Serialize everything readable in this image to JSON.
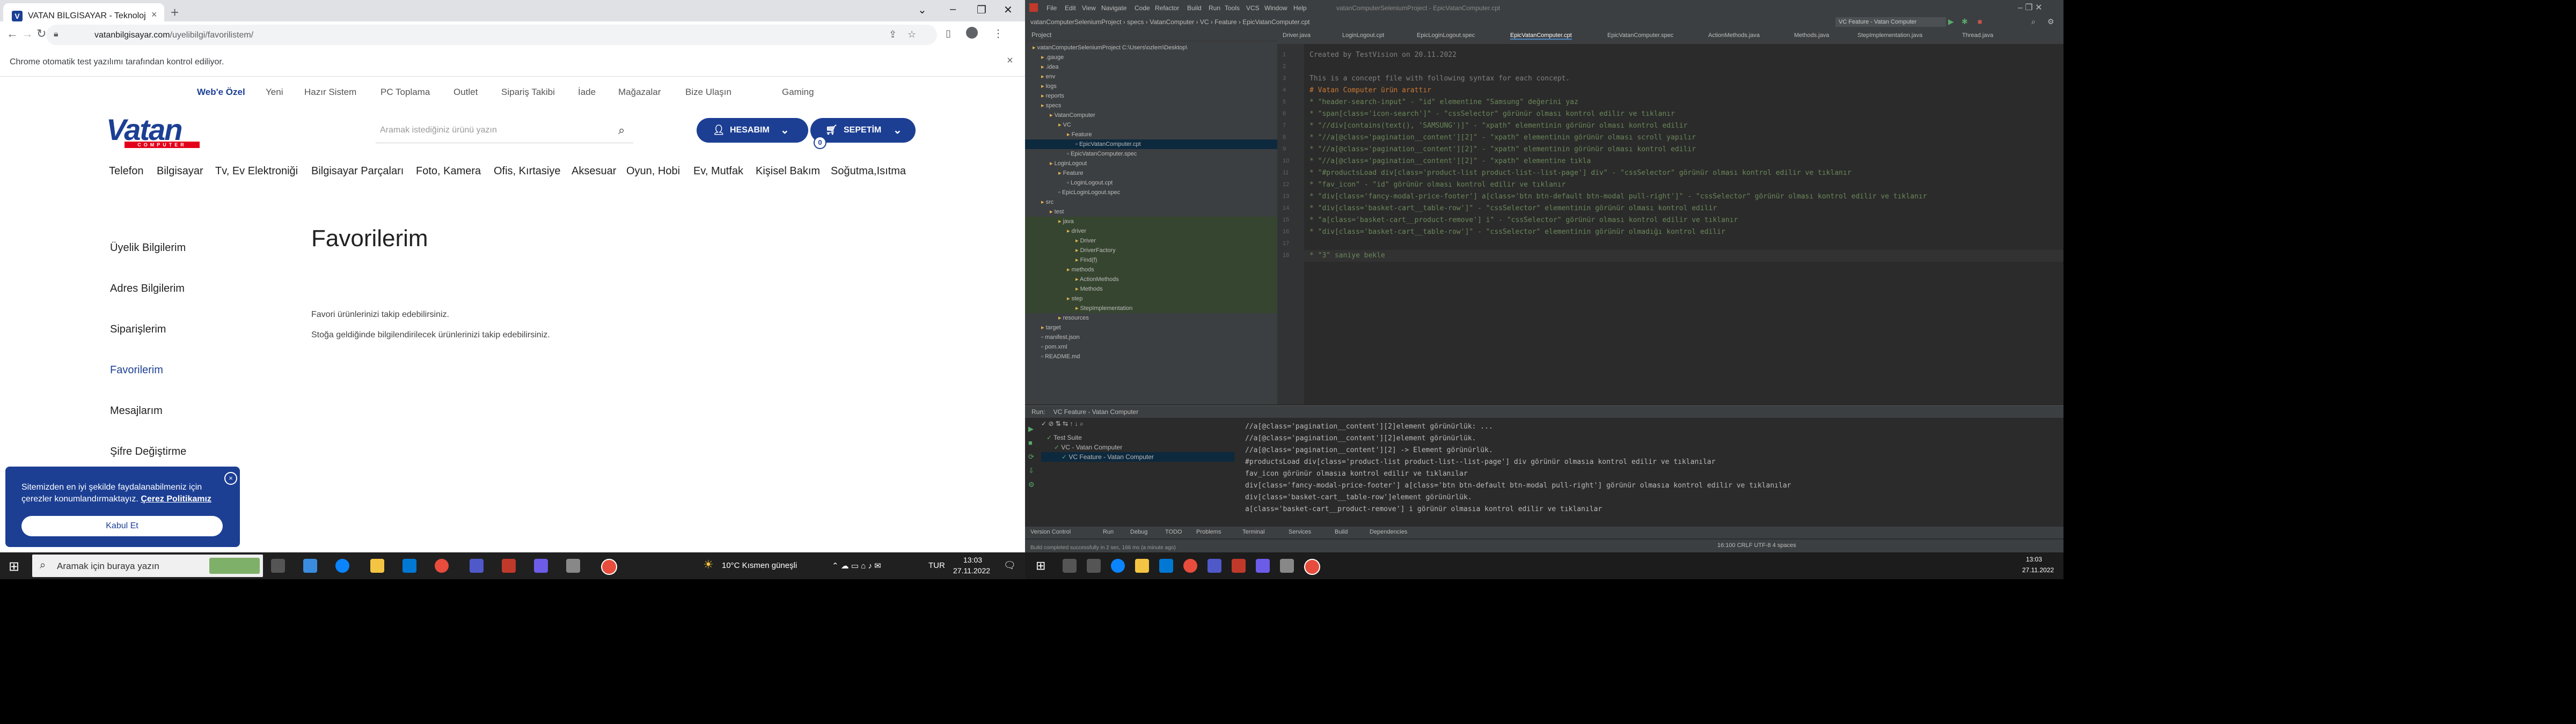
{
  "browser": {
    "tab_title": "VATAN BİLGİSAYAR - Teknoloji d...",
    "tab_close": "×",
    "new_tab": "+",
    "url_host": "vatanbilgisayar.com",
    "url_path": "/uyelibilgi/favorilistem/",
    "infobar_text": "Chrome otomatik test yazılımı tarafından kontrol ediliyor.",
    "infobar_close": "×"
  },
  "site": {
    "top_links": [
      "Web'e Özel",
      "Yeni",
      "Hazır Sistem",
      "PC Toplama",
      "Outlet",
      "Sipariş Takibi",
      "İade",
      "Mağazalar",
      "Bize Ulaşın",
      "Gaming"
    ],
    "logo_text": "Vatan",
    "logo_sub": "COMPUTER",
    "search_placeholder": "Aramak istediğiniz ürünü yazın",
    "account_label": "HESABIM",
    "cart_label": "SEPETİM",
    "cart_count": "0",
    "categories": [
      "Telefon",
      "Bilgisayar",
      "Tv, Ev Elektroniği",
      "Bilgisayar Parçaları",
      "Foto, Kamera",
      "Ofis, Kırtasiye",
      "Aksesuar",
      "Oyun, Hobi",
      "Ev, Mutfak",
      "Kişisel Bakım",
      "Soğutma,Isıtma"
    ],
    "sidebar": [
      "Üyelik Bilgilerim",
      "Adres Bilgilerim",
      "Siparişlerim",
      "Favorilerim",
      "Mesajlarım",
      "Şifre Değiştirme"
    ],
    "page_title": "Favorilerim",
    "info_line_1": "Favori ürünlerinizi takip edebilirsiniz.",
    "info_line_2": "Stoğa geldiğinde bilgilendirilecek ürünlerinizi takip edebilirsiniz.",
    "cookie_text": "Sitemizden en iyi şekilde faydalanabilmeniz için çerezler konumlandırmaktayız.",
    "cookie_link": "Çerez Politikamız",
    "cookie_accept": "Kabul Et",
    "cookie_close": "×"
  },
  "taskbar_left": {
    "search_placeholder": "Aramak için buraya yazın",
    "weather": "10°C  Kısmen güneşli",
    "lang": "TUR",
    "time": "13:03",
    "date": "27.11.2022"
  },
  "taskbar_right": {
    "time": "13:03",
    "date": "27.11.2022"
  },
  "ide": {
    "menu": [
      "File",
      "Edit",
      "View",
      "Navigate",
      "Code",
      "Refactor",
      "Build",
      "Run",
      "Tools",
      "VCS",
      "Window",
      "Help"
    ],
    "title_suffix": "vatanComputerSeleniumProject - EpicVatanComputer.cpt",
    "breadcrumb": "vatanComputerSeleniumProject  ›  specs  ›  VatanComputer  ›  VC  ›  Feature  ›  EpicVatanComputer.cpt",
    "run_config": "VC Feature - Vatan Computer",
    "project_label": "Project",
    "tree": [
      {
        "t": "vatanComputerSeleniumProject  C:\\Users\\ozlem\\Desktop\\",
        "d": 0
      },
      {
        "t": ".gauge",
        "d": 1
      },
      {
        "t": ".idea",
        "d": 1
      },
      {
        "t": "env",
        "d": 1
      },
      {
        "t": "logs",
        "d": 1
      },
      {
        "t": "reports",
        "d": 1
      },
      {
        "t": "specs",
        "d": 1
      },
      {
        "t": "VatanComputer",
        "d": 2
      },
      {
        "t": "VC",
        "d": 3
      },
      {
        "t": "Feature",
        "d": 4
      },
      {
        "t": "EpicVatanComputer.cpt",
        "d": 5,
        "sel": true
      },
      {
        "t": "EpicVatanComputer.spec",
        "d": 4
      },
      {
        "t": "LoginLogout",
        "d": 2
      },
      {
        "t": "Feature",
        "d": 3
      },
      {
        "t": "LoginLogout.cpt",
        "d": 4
      },
      {
        "t": "EpicLoginLogout.spec",
        "d": 3
      },
      {
        "t": "src",
        "d": 1
      },
      {
        "t": "test",
        "d": 2
      },
      {
        "t": "java",
        "d": 3,
        "green": true
      },
      {
        "t": "driver",
        "d": 4,
        "green": true
      },
      {
        "t": "Driver",
        "d": 5,
        "green": true
      },
      {
        "t": "DriverFactory",
        "d": 5,
        "green": true
      },
      {
        "t": "Find(f)",
        "d": 5,
        "green": true
      },
      {
        "t": "methods",
        "d": 4,
        "green": true
      },
      {
        "t": "ActionMethods",
        "d": 5,
        "green": true
      },
      {
        "t": "Methods",
        "d": 5,
        "green": true
      },
      {
        "t": "step",
        "d": 4,
        "green": true
      },
      {
        "t": "StepImplementation",
        "d": 5,
        "green": true
      },
      {
        "t": "resources",
        "d": 3
      },
      {
        "t": "target",
        "d": 1
      },
      {
        "t": "manifest.json",
        "d": 1
      },
      {
        "t": "pom.xml",
        "d": 1
      },
      {
        "t": "README.md",
        "d": 1
      }
    ],
    "editor_tabs": [
      "Driver.java",
      "LoginLogout.cpt",
      "EpicLoginLogout.spec",
      "EpicVatanComputer.cpt",
      "EpicVatanComputer.spec",
      "ActionMethods.java",
      "Methods.java",
      "StepImplementation.java",
      "Thread.java"
    ],
    "active_tab_index": 3,
    "code_lines": [
      {
        "n": "1",
        "t": "Created by TestVision on 20.11.2022",
        "c": "c-comment"
      },
      {
        "n": "2",
        "t": "",
        "c": ""
      },
      {
        "n": "3",
        "t": "This is a concept file with following syntax for each concept.",
        "c": "c-comment"
      },
      {
        "n": "4",
        "t": "# Vatan Computer ürün arattır",
        "c": "c-kw"
      },
      {
        "n": "5",
        "t": "* \"header-search-input\" - \"id\" elementine \"Samsung\" değerini yaz",
        "c": "c-green"
      },
      {
        "n": "6",
        "t": "* \"span[class='icon-search']\" - \"cssSelector\" görünür olması kontrol edilir ve tıklanır",
        "c": "c-green"
      },
      {
        "n": "7",
        "t": "* \"//div[contains(text(), 'SAMSUNG')]\" - \"xpath\" elementinin görünür olması kontrol edilir",
        "c": "c-green"
      },
      {
        "n": "8",
        "t": "* \"//a[@class='pagination__content'][2]\" - \"xpath\" elementinin görünür olması scroll yapılır",
        "c": "c-green"
      },
      {
        "n": "9",
        "t": "* \"//a[@class='pagination__content'][2]\" - \"xpath\" elementinin görünür olması kontrol edilir",
        "c": "c-green"
      },
      {
        "n": "10",
        "t": "* \"//a[@class='pagination__content'][2]\" - \"xpath\" elementine tıkla",
        "c": "c-green"
      },
      {
        "n": "11",
        "t": "* \"#productsLoad div[class='product-list product-list--list-page'] div\" - \"cssSelector\" görünür olması kontrol edilir ve tıklanır",
        "c": "c-green"
      },
      {
        "n": "12",
        "t": "* \"fav_icon\" - \"id\" görünür olması kontrol edilir ve tıklanır",
        "c": "c-green"
      },
      {
        "n": "13",
        "t": "* \"div[class='fancy-modal-price-footer'] a[class='btn btn-default btn-modal pull-right']\" - \"cssSelector\" görünür olması kontrol edilir ve tıklanır",
        "c": "c-green"
      },
      {
        "n": "14",
        "t": "* \"div[class='basket-cart__table-row']\" - \"cssSelector\" elementinin görünür olması kontrol edilir",
        "c": "c-green"
      },
      {
        "n": "15",
        "t": "* \"a[class='basket-cart__product-remove'] i\" - \"cssSelector\" görünür olması kontrol edilir ve tıklanır",
        "c": "c-green"
      },
      {
        "n": "16",
        "t": "* \"div[class='basket-cart__table-row']\" - \"cssSelector\" elementinin görünür olmadığı kontrol edilir",
        "c": "c-green"
      },
      {
        "n": "17",
        "t": "",
        "c": ""
      },
      {
        "n": "18",
        "t": "* \"3\" saniye bekle",
        "c": "c-green"
      }
    ],
    "run_label": "Run:",
    "run_config_tab": "VC Feature - Vatan Computer",
    "run_tree": [
      "Test Suite",
      "VC - Vatan Computer",
      "VC Feature - Vatan Computer"
    ],
    "run_output": [
      "//a[@class='pagination__content'][2]element görünürlük: ...",
      "//a[@class='pagination__content'][2]element görünürlük. ",
      "//a[@class='pagination__content'][2] -> Element görünürlük.",
      "#productsLoad div[class='product-list product-list--list-page'] div görünür olmasıa kontrol edilir ve tıklanılar",
      "fav_icon görünür olmasıa kontrol edilir ve tıklanılar",
      "div[class='fancy-modal-price-footer'] a[class='btn btn-default btn-modal pull-right'] görünür olmasıa kontrol edilir ve tıklanılar",
      "div[class='basket-cart__table-row']element görünürlük.",
      "a[class='basket-cart__product-remove'] i görünür olmasıa kontrol edilir ve tıklanılar"
    ],
    "bottom_tabs": [
      "Version Control",
      "Run",
      "Debug",
      "TODO",
      "Problems",
      "Terminal",
      "Services",
      "Build",
      "Dependencies"
    ],
    "status_left": "Build completed successfully in 2 sec, 166 ms (a minute ago)",
    "status_right": "16:100  CRLF  UTF-8  4 spaces"
  },
  "colors": {
    "vatan_blue": "#1c3f94",
    "vatan_red": "#e3001b",
    "ide_bg": "#2b2b2b"
  }
}
